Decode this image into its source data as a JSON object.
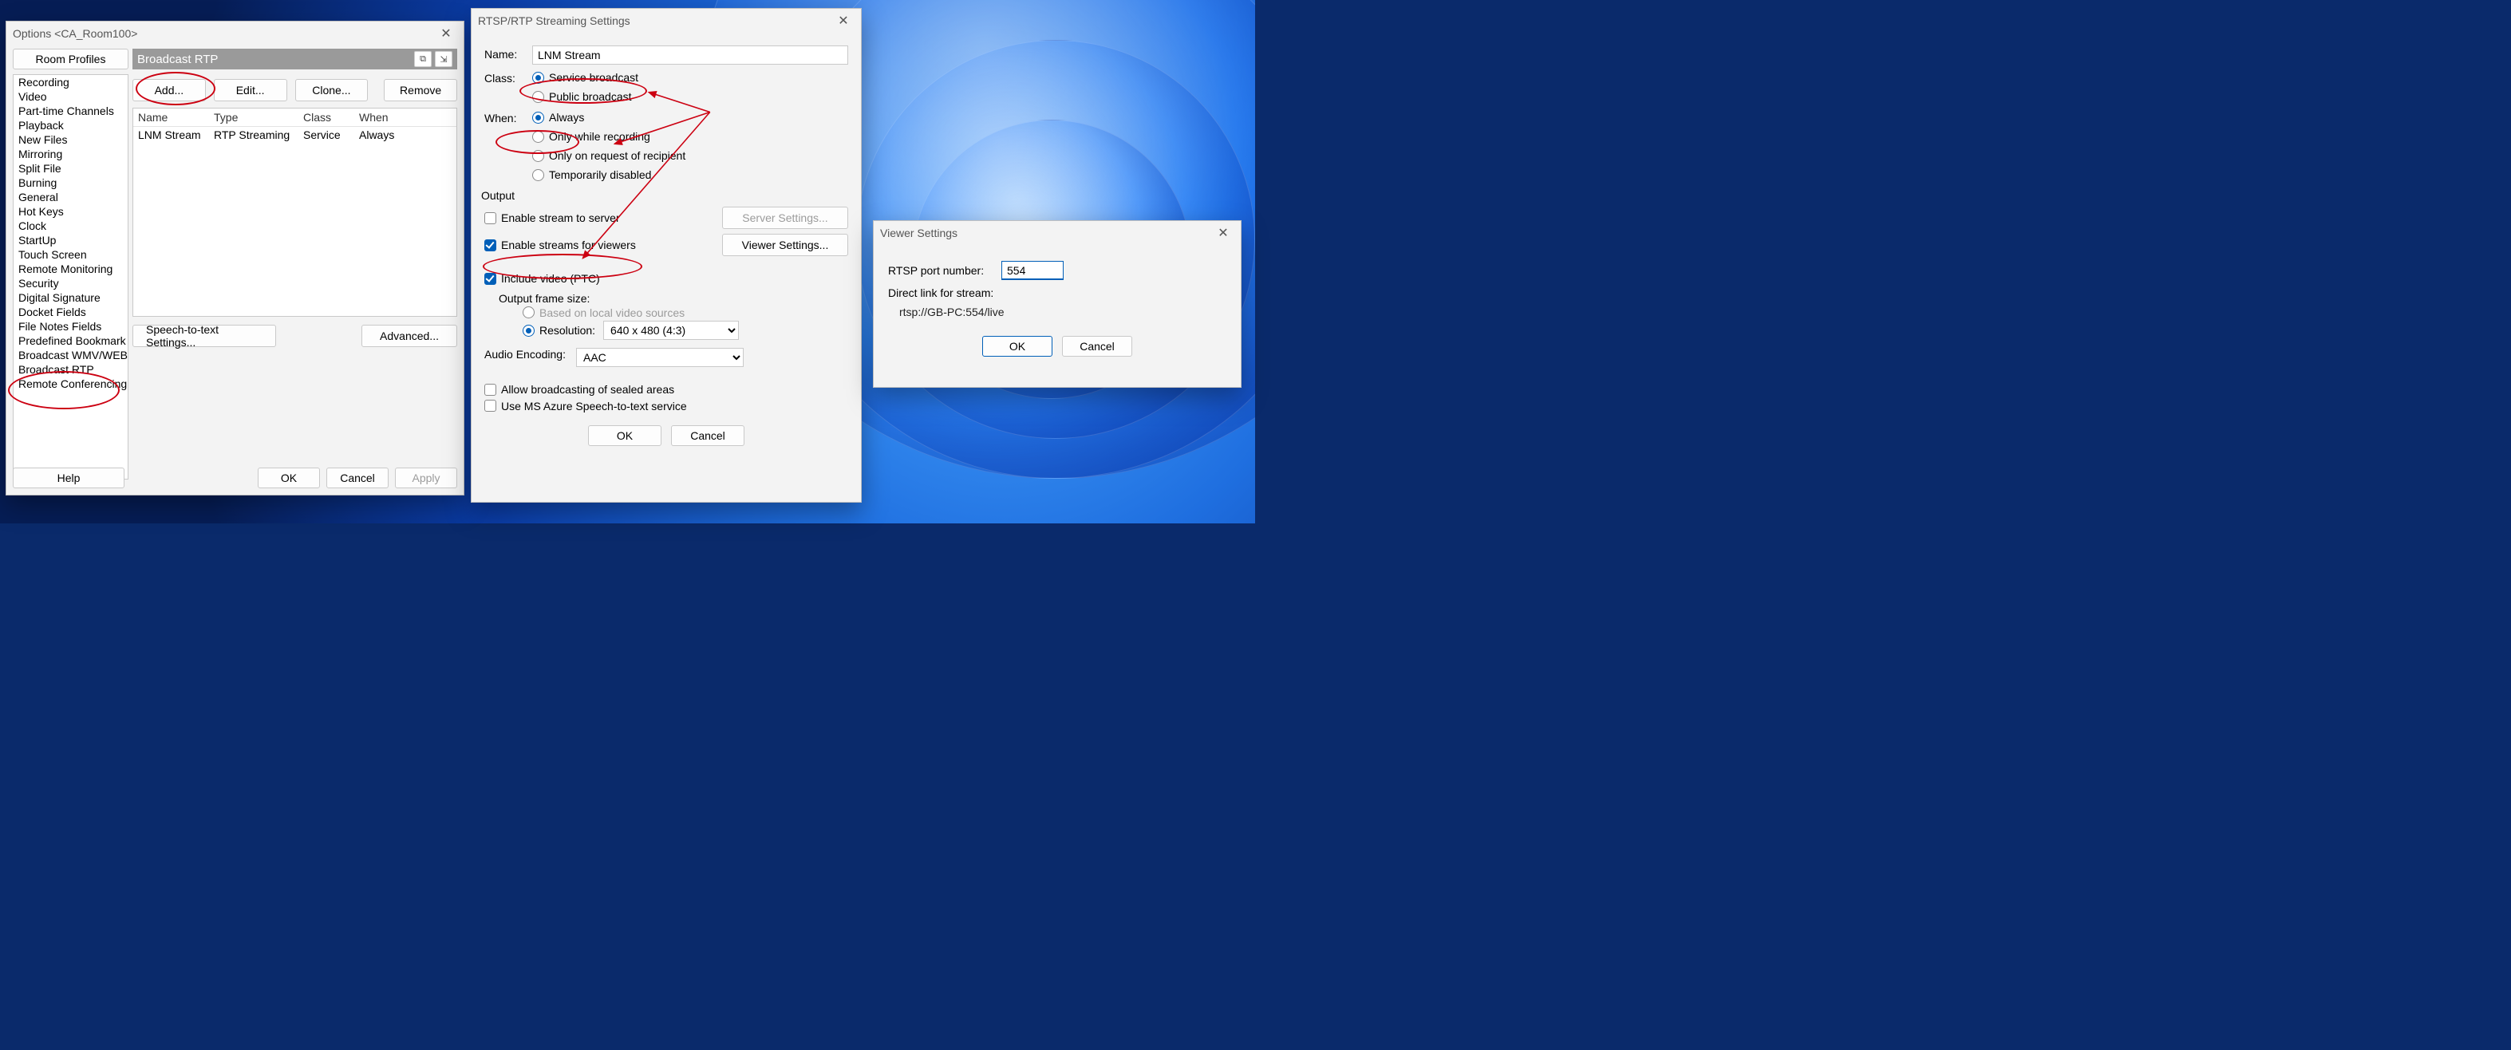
{
  "options": {
    "title": "Options <CA_Room100>",
    "room_profiles_btn": "Room Profiles",
    "panel_title": "Broadcast RTP",
    "sidebar": {
      "items": [
        "Recording",
        "Video",
        "Part-time Channels",
        "Playback",
        "New Files",
        "Mirroring",
        "Split File",
        "Burning",
        "General",
        "Hot Keys",
        "Clock",
        "StartUp",
        "Touch Screen",
        "Remote Monitoring",
        "Security",
        "Digital Signature",
        "Docket Fields",
        "File Notes Fields",
        "Predefined Bookmark",
        "Broadcast WMV/WEB",
        "Broadcast RTP",
        "Remote Conferencing"
      ]
    },
    "toolbar": {
      "add": "Add...",
      "edit": "Edit...",
      "clone": "Clone...",
      "remove": "Remove"
    },
    "grid": {
      "headers": {
        "name": "Name",
        "type": "Type",
        "class": "Class",
        "when": "When"
      },
      "rows": [
        {
          "name": "LNM Stream",
          "type": "RTP Streaming",
          "class": "Service",
          "when": "Always"
        }
      ]
    },
    "stt_btn": "Speech-to-text Settings...",
    "adv_btn": "Advanced...",
    "footer": {
      "help": "Help",
      "ok": "OK",
      "cancel": "Cancel",
      "apply": "Apply"
    }
  },
  "rtsp": {
    "title": "RTSP/RTP Streaming Settings",
    "name_label": "Name:",
    "name_value": "LNM Stream",
    "class_label": "Class:",
    "class_options": {
      "service": "Service broadcast",
      "public": "Public broadcast"
    },
    "when_label": "When:",
    "when_options": {
      "always": "Always",
      "recording": "Only while recording",
      "request": "Only on request of recipient",
      "disabled": "Temporarily disabled"
    },
    "output_label": "Output",
    "enable_server": "Enable stream to server",
    "server_settings_btn": "Server Settings...",
    "enable_viewers": "Enable streams for viewers",
    "viewer_settings_btn": "Viewer Settings...",
    "include_video": "Include video (PTC)",
    "frame_size_label": "Output frame size:",
    "frame_based": "Based on local video sources",
    "frame_res_label": "Resolution:",
    "frame_res_value": "640 x 480  (4:3)",
    "audio_label": "Audio Encoding:",
    "audio_value": "AAC",
    "allow_sealed": "Allow broadcasting of sealed areas",
    "use_azure": "Use MS Azure Speech-to-text service",
    "ok": "OK",
    "cancel": "Cancel"
  },
  "viewer": {
    "title": "Viewer Settings",
    "port_label": "RTSP port number:",
    "port_value": "554",
    "link_label": "Direct link for stream:",
    "link_value": "rtsp://GB-PC:554/live",
    "ok": "OK",
    "cancel": "Cancel"
  }
}
